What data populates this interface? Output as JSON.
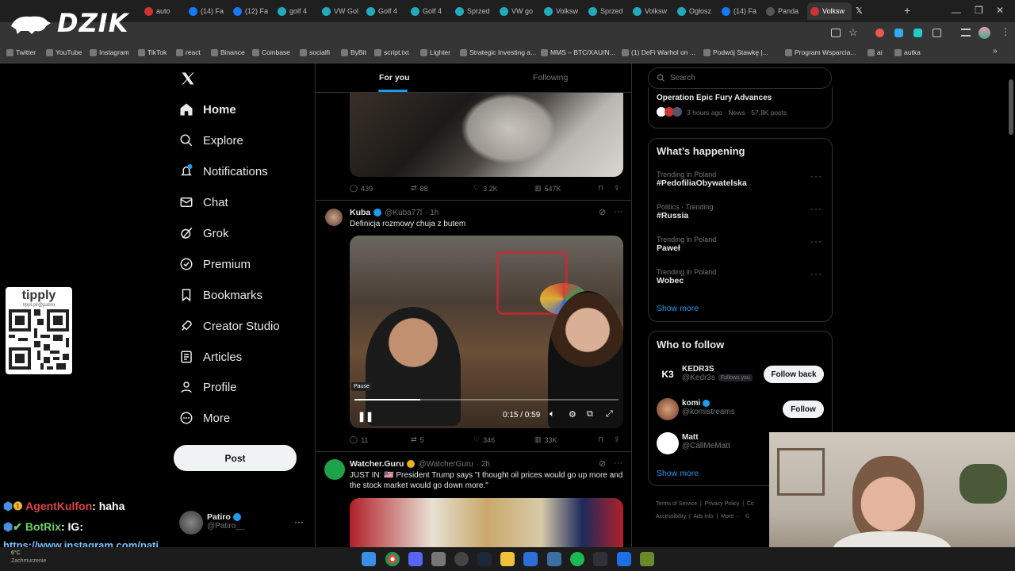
{
  "browser": {
    "tabs": [
      {
        "label": "auto",
        "color": "#c33"
      },
      {
        "label": "(14) Fa",
        "color": "#1877f2"
      },
      {
        "label": "(12) Fa",
        "color": "#1877f2"
      },
      {
        "label": "golf 4",
        "color": "#2ab"
      },
      {
        "label": "VW Gol",
        "color": "#2ab"
      },
      {
        "label": "Golf 4",
        "color": "#2ab"
      },
      {
        "label": "Golf 4",
        "color": "#2ab"
      },
      {
        "label": "Sprzed",
        "color": "#2ab"
      },
      {
        "label": "VW go",
        "color": "#2ab"
      },
      {
        "label": "Volksw",
        "color": "#2ab"
      },
      {
        "label": "Sprzed",
        "color": "#2ab"
      },
      {
        "label": "Volksw",
        "color": "#2ab"
      },
      {
        "label": "Ogłosz",
        "color": "#2ab"
      },
      {
        "label": "(14) Fa",
        "color": "#1877f2"
      },
      {
        "label": "Panda",
        "color": "#555"
      },
      {
        "label": "Volksw",
        "color": "#c33"
      }
    ],
    "bookmarks": [
      "Twitter",
      "YouTube",
      "Instagram",
      "TikTok",
      "react",
      "Binance",
      "Coinbase",
      "socialfi",
      "ByBit",
      "script.txt",
      "Lighter",
      "Strategic Investing a...",
      "MMS – BTC/XAU/N...",
      "(1) DeFi Warhol on ...",
      "Podwój Stawkę |...",
      "Program Wsparcia...",
      "ai",
      "autka"
    ]
  },
  "overlay": {
    "logo": "DZIK",
    "tipply": "tipply",
    "tipply_url": "tippl.pl/@patiro",
    "chat": [
      {
        "user": "AgentKulfon",
        "msg": ": haha",
        "color": "#e0424c"
      },
      {
        "user": "BotRix",
        "msg": ": IG:",
        "color": "#6cd46c"
      }
    ],
    "chat_link": "https://www.instagram.com/patiro",
    "weather": "6°C",
    "weather_sub": "Zachmurzenie"
  },
  "sidebar": {
    "items": [
      "Home",
      "Explore",
      "Notifications",
      "Chat",
      "Grok",
      "Premium",
      "Bookmarks",
      "Creator Studio",
      "Articles",
      "Profile",
      "More"
    ],
    "post": "Post",
    "user_name": "Patiro",
    "user_handle": "@Patiro__"
  },
  "feed": {
    "tabs": [
      "For you",
      "Following"
    ],
    "post1": {
      "replies": "439",
      "reposts": "88",
      "likes": "3.2K",
      "views": "547K"
    },
    "post2": {
      "name": "Kuba",
      "handle": "@Kuba77l",
      "time": "· 1h",
      "text": "Definicja rozmowy chuja z butem",
      "tooltip": "Pause",
      "time_display": "0:15 / 0:59",
      "progress": 0.25,
      "replies": "11",
      "reposts": "5",
      "likes": "346",
      "views": "33K"
    },
    "post3": {
      "name": "Watcher.Guru",
      "handle": "@WatcherGuru",
      "time": "· 2h",
      "text": "JUST IN: 🇺🇸 President Trump says \"I thought oil prices would go up more and the stock market would go down more.\""
    }
  },
  "right": {
    "search_placeholder": "Search",
    "news": {
      "title": "Operation Epic Fury Advances",
      "meta": "3 hours ago · News · 57.8K posts"
    },
    "happening": {
      "title": "What’s happening",
      "trends": [
        {
          "context": "Trending in Poland",
          "name": "#PedofiliaObywatelska"
        },
        {
          "context": "Politics · Trending",
          "name": "#Russia"
        },
        {
          "context": "Trending in Poland",
          "name": "Paweł"
        },
        {
          "context": "Trending in Poland",
          "name": "Wobec"
        }
      ],
      "show_more": "Show more"
    },
    "wtf": {
      "title": "Who to follow",
      "users": [
        {
          "name": "KEDR3S",
          "handle": "@Kedr3s",
          "badge": "Follows you",
          "button": "Follow back"
        },
        {
          "name": "komi",
          "handle": "@komistreams",
          "badge": "",
          "button": "Follow"
        },
        {
          "name": "Matt",
          "handle": "@CallMeMatt",
          "badge": "",
          "button": ""
        }
      ],
      "show_more": "Show more"
    },
    "footer": [
      "Terms of Service",
      "Privacy Policy",
      "Co",
      "Accessibility",
      "Ads info",
      "More ···",
      "©"
    ]
  }
}
